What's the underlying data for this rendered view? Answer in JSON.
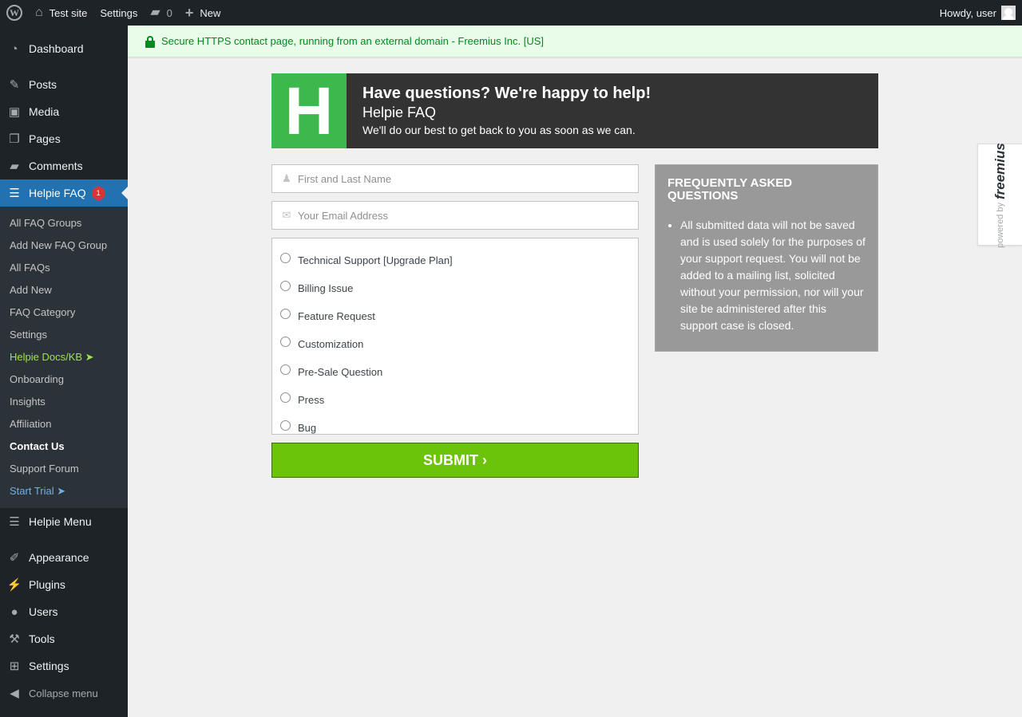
{
  "admin_bar": {
    "site_name": "Test site",
    "settings": "Settings",
    "comments_count": "0",
    "new": "New",
    "greeting": "Howdy, user"
  },
  "menu": {
    "dashboard": "Dashboard",
    "posts": "Posts",
    "media": "Media",
    "pages": "Pages",
    "comments": "Comments",
    "helpie_faq": "Helpie FAQ",
    "helpie_badge": "1",
    "submenu": {
      "all_groups": "All FAQ Groups",
      "add_group": "Add New FAQ Group",
      "all_faqs": "All FAQs",
      "add_new": "Add New",
      "category": "FAQ Category",
      "settings": "Settings",
      "docs": "Helpie Docs/KB ➤",
      "onboarding": "Onboarding",
      "insights": "Insights",
      "affiliation": "Affiliation",
      "contact": "Contact Us",
      "forum": "Support Forum",
      "trial": "Start Trial  ➤"
    },
    "helpie_menu": "Helpie Menu",
    "appearance": "Appearance",
    "plugins": "Plugins",
    "users": "Users",
    "tools": "Tools",
    "settings": "Settings",
    "collapse": "Collapse menu"
  },
  "notice": "Secure HTTPS contact page, running from an external domain - Freemius Inc. [US]",
  "header": {
    "logo_letter": "H",
    "title": "Have questions? We're happy to help!",
    "plugin": "Helpie FAQ",
    "subtitle": "We'll do our best to get back to you as soon as we can."
  },
  "form": {
    "name_placeholder": "First and Last Name",
    "email_placeholder": "Your Email Address",
    "types": [
      "Technical Support [Upgrade Plan]",
      "Billing Issue",
      "Feature Request",
      "Customization",
      "Pre-Sale Question",
      "Press",
      "Bug"
    ],
    "submit": "SUBMIT ›"
  },
  "faq": {
    "title": "FREQUENTLY ASKED QUESTIONS",
    "items": [
      "All submitted data will not be saved and is used solely for the purposes of your support request. You will not be added to a mailing list, solicited without your permission, nor will your site be administered after this support case is closed."
    ]
  },
  "freemius": {
    "powered_by": "powered by",
    "brand": "freemius"
  },
  "colors": {
    "admin_bg": "#1d2327",
    "current_menu": "#2271b1",
    "logo_green": "#3cb84c",
    "submit_green": "#6bc40a",
    "notice_green": "#008a20"
  }
}
